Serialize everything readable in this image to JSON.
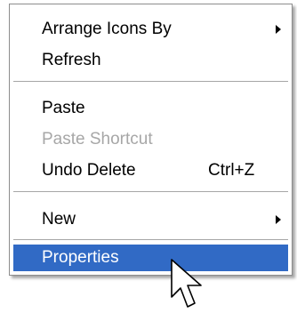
{
  "menu": {
    "items": [
      {
        "label": "Arrange Icons By",
        "has_submenu": true
      },
      {
        "label": "Refresh"
      },
      {
        "label": "Paste"
      },
      {
        "label": "Paste Shortcut",
        "disabled": true
      },
      {
        "label": "Undo Delete",
        "shortcut": "Ctrl+Z"
      },
      {
        "label": "New",
        "has_submenu": true
      },
      {
        "label": "Properties",
        "highlighted": true
      }
    ]
  },
  "colors": {
    "highlight": "#316ac5",
    "disabled_text": "#a7a7a7",
    "border": "#8d8d8d"
  },
  "icons": {
    "pointer": "mouse-pointer-icon",
    "submenu": "submenu-arrow-icon"
  }
}
